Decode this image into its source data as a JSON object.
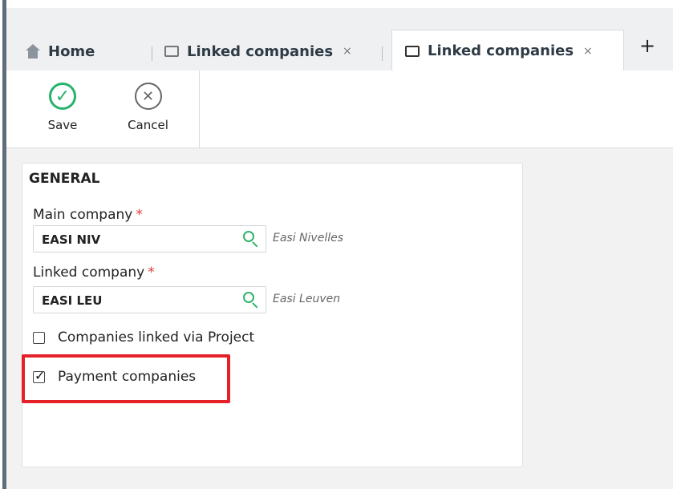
{
  "tabs": [
    {
      "label": "Home",
      "icon": "home-icon"
    },
    {
      "label": "Linked companies",
      "icon": "window-icon",
      "close": "×"
    },
    {
      "label": "Linked companies",
      "icon": "window-icon",
      "close": "×"
    }
  ],
  "add_tab": "+",
  "toolbar": {
    "save": {
      "label": "Save",
      "icon": "check-circle-icon",
      "color": "#25b36b"
    },
    "cancel": {
      "label": "Cancel",
      "icon": "x-circle-icon"
    }
  },
  "form": {
    "section_title": "GENERAL",
    "main_company": {
      "label": "Main company",
      "required": "*",
      "value": "EASI NIV",
      "hint": "Easi Nivelles"
    },
    "linked_company": {
      "label": "Linked company",
      "required": "*",
      "value": "EASI LEU",
      "hint": "Easi Leuven"
    },
    "companies_via_project": {
      "label": "Companies linked via Project",
      "checked": false
    },
    "payment_companies": {
      "label": "Payment companies",
      "checked": true
    }
  },
  "highlight_color": "#e32127"
}
